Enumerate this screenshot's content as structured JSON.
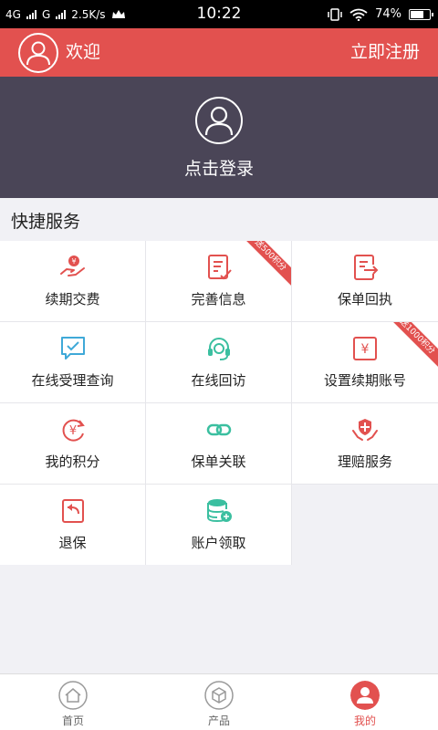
{
  "status_bar": {
    "net1": "4G",
    "net2": "G",
    "speed": "2.5K/s",
    "time": "10:22",
    "battery": "74%",
    "battery_level": 0.74
  },
  "header": {
    "welcome": "欢迎",
    "register": "立即注册"
  },
  "banner": {
    "login": "点击登录"
  },
  "quick_services": {
    "title": "快捷服务",
    "items": [
      {
        "label": "续期交费",
        "icon": "hand-yen-icon"
      },
      {
        "label": "完善信息",
        "icon": "edit-document-icon",
        "badge": "送500积分"
      },
      {
        "label": "保单回执",
        "icon": "document-export-icon"
      },
      {
        "label": "在线受理查询",
        "icon": "chat-check-icon"
      },
      {
        "label": "在线回访",
        "icon": "headset-icon"
      },
      {
        "label": "设置续期账号",
        "icon": "yen-card-icon",
        "badge": "送1000积分"
      },
      {
        "label": "我的积分",
        "icon": "yen-cycle-icon"
      },
      {
        "label": "保单关联",
        "icon": "link-icon"
      },
      {
        "label": "理赔服务",
        "icon": "shield-hands-icon"
      },
      {
        "label": "退保",
        "icon": "return-doc-icon"
      },
      {
        "label": "账户领取",
        "icon": "coins-stack-icon"
      }
    ]
  },
  "tabbar": {
    "items": [
      {
        "label": "首页",
        "icon": "home-icon"
      },
      {
        "label": "产品",
        "icon": "box-icon"
      },
      {
        "label": "我的",
        "icon": "user-icon",
        "active": true
      }
    ]
  },
  "colors": {
    "brand_red": "#e2514f",
    "banner_bg": "#4a4557",
    "icon_teal": "#3bbfa0",
    "icon_blue": "#3fa9d8"
  }
}
